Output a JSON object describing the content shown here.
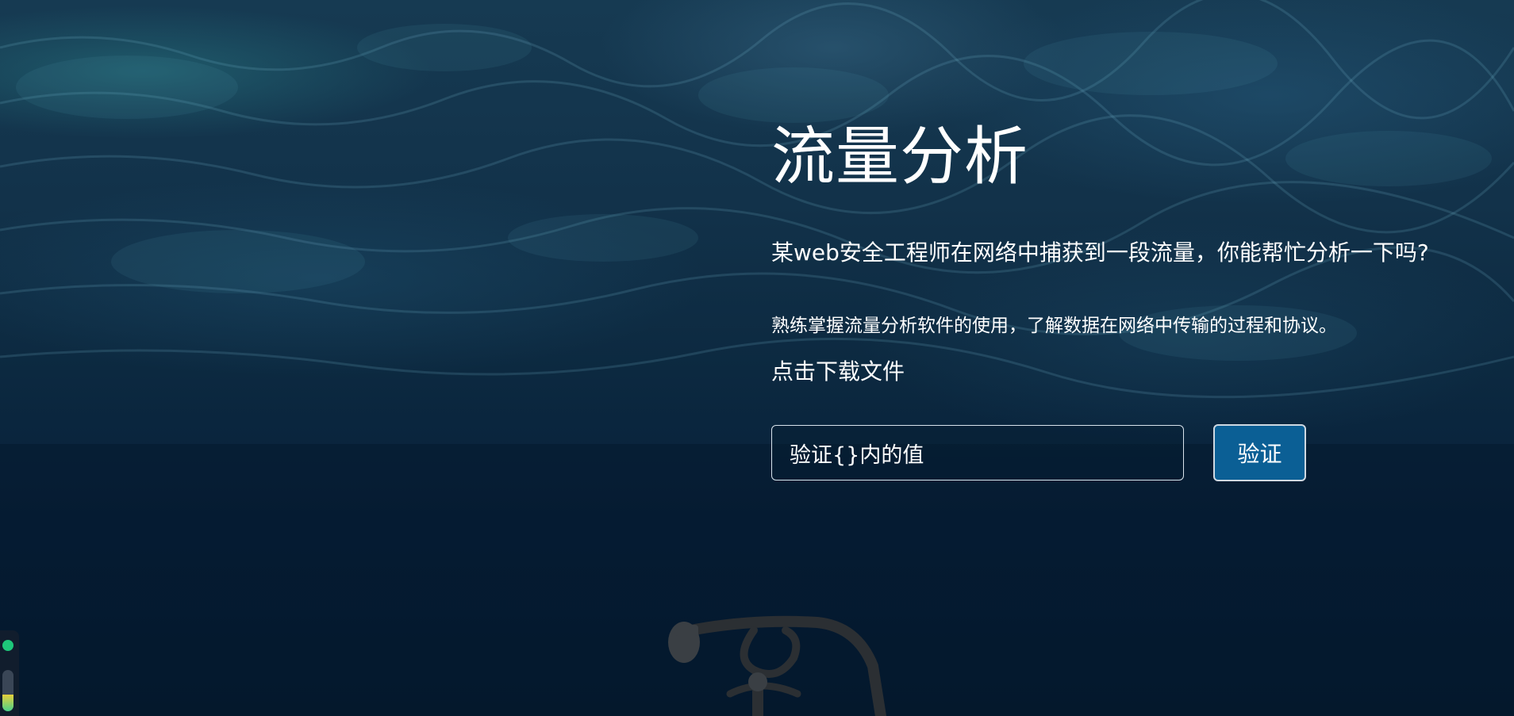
{
  "page": {
    "title": "流量分析",
    "subtitle": "某web安全工程师在网络中捕获到一段流量，你能帮忙分析一下吗?",
    "description": "熟练掌握流量分析软件的使用，了解数据在网络中传输的过程和协议。",
    "download_link": "点击下载文件"
  },
  "form": {
    "placeholder": "验证{}内的值",
    "button_label": "验证"
  },
  "side_widget": {
    "status_color": "#1ec77a",
    "level": 0.4
  },
  "colors": {
    "button_bg": "#0b5f95",
    "background": "#0c2940",
    "text": "#ffffff"
  }
}
